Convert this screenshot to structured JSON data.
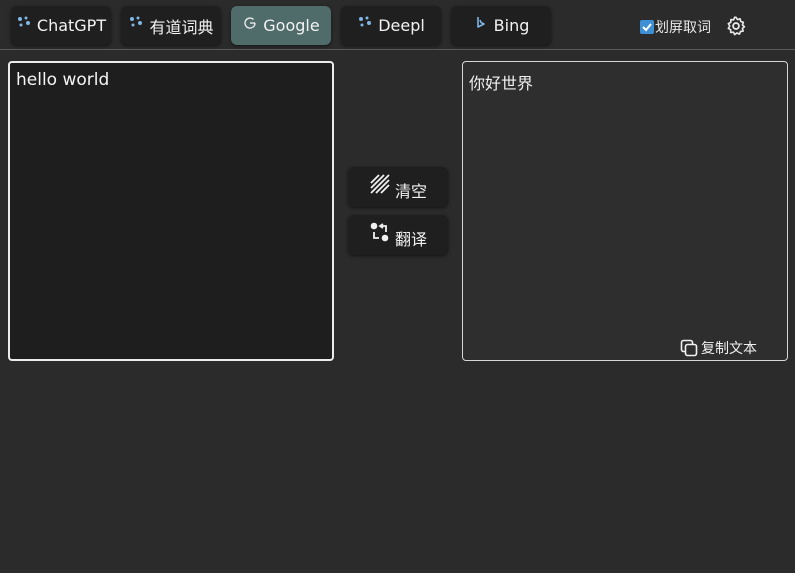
{
  "tabs": [
    {
      "label": "ChatGPT",
      "icon": "sparkle-dots-icon",
      "active": false
    },
    {
      "label": "有道词典",
      "icon": "sparkle-dots-icon",
      "active": false
    },
    {
      "label": "Google",
      "icon": "google-g-icon",
      "active": true
    },
    {
      "label": "Deepl",
      "icon": "sparkle-dots-icon",
      "active": false
    },
    {
      "label": "Bing",
      "icon": "bing-icon",
      "active": false
    }
  ],
  "toggle": {
    "label": "划屏取词",
    "checked": true
  },
  "input": {
    "value": "hello world"
  },
  "output": {
    "text": "你好世界",
    "copy_label": "复制文本"
  },
  "actions": {
    "clear_label": "清空",
    "translate_label": "翻译"
  },
  "colors": {
    "accent_tab": "#4f6b6a",
    "checkbox": "#3d8fd6",
    "background": "#2b2b2b"
  }
}
